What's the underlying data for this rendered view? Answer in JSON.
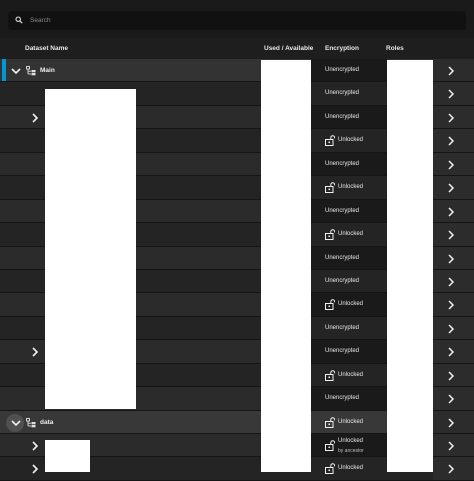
{
  "search": {
    "placeholder": "Search"
  },
  "columns": {
    "name": "Dataset Name",
    "used": "Used / Available",
    "encryption": "Encryption",
    "roles": "Roles"
  },
  "rows": [
    {
      "name": "Main",
      "encryption": "Unencrypted",
      "expander": "expanded",
      "selected": true
    },
    {
      "name": "",
      "encryption": "Unencrypted",
      "expander": "none"
    },
    {
      "name": "",
      "encryption": "Unencrypted",
      "expander": "collapsed"
    },
    {
      "name": "",
      "encryption": "Unlocked",
      "lock": true,
      "expander": "none"
    },
    {
      "name": "",
      "encryption": "Unencrypted",
      "expander": "none"
    },
    {
      "name": "",
      "encryption": "Unlocked",
      "lock": true,
      "expander": "none"
    },
    {
      "name": "",
      "encryption": "Unencrypted",
      "expander": "none"
    },
    {
      "name": "",
      "encryption": "Unlocked",
      "lock": true,
      "expander": "none"
    },
    {
      "name": "",
      "encryption": "Unencrypted",
      "expander": "none"
    },
    {
      "name": "",
      "encryption": "Unencrypted",
      "expander": "none"
    },
    {
      "name": "",
      "encryption": "Unlocked",
      "lock": true,
      "expander": "none"
    },
    {
      "name": "",
      "encryption": "Unencrypted",
      "expander": "none"
    },
    {
      "name": "",
      "encryption": "Unencrypted",
      "expander": "collapsed"
    },
    {
      "name": "",
      "encryption": "Unlocked",
      "lock": true,
      "expander": "none"
    },
    {
      "name": "",
      "encryption": "Unencrypted",
      "expander": "none"
    },
    {
      "name": "data",
      "encryption": "Unlocked",
      "lock": true,
      "expander": "expanded-hover",
      "highlight": true
    },
    {
      "name": "",
      "encryption": "Unlocked",
      "encryption_sub": "by ancestor",
      "lock": true,
      "expander": "collapsed"
    },
    {
      "name": "",
      "encryption": "Unlocked",
      "lock": true,
      "expander": "collapsed"
    }
  ],
  "colors": {
    "accent": "#0095d5",
    "background": "#1e1e1e"
  },
  "icons": {
    "search": "search-icon",
    "dataset": "dataset-tree-icon",
    "lock": "unlocked-padlock-icon",
    "row_action": "chevron-right-icon"
  }
}
